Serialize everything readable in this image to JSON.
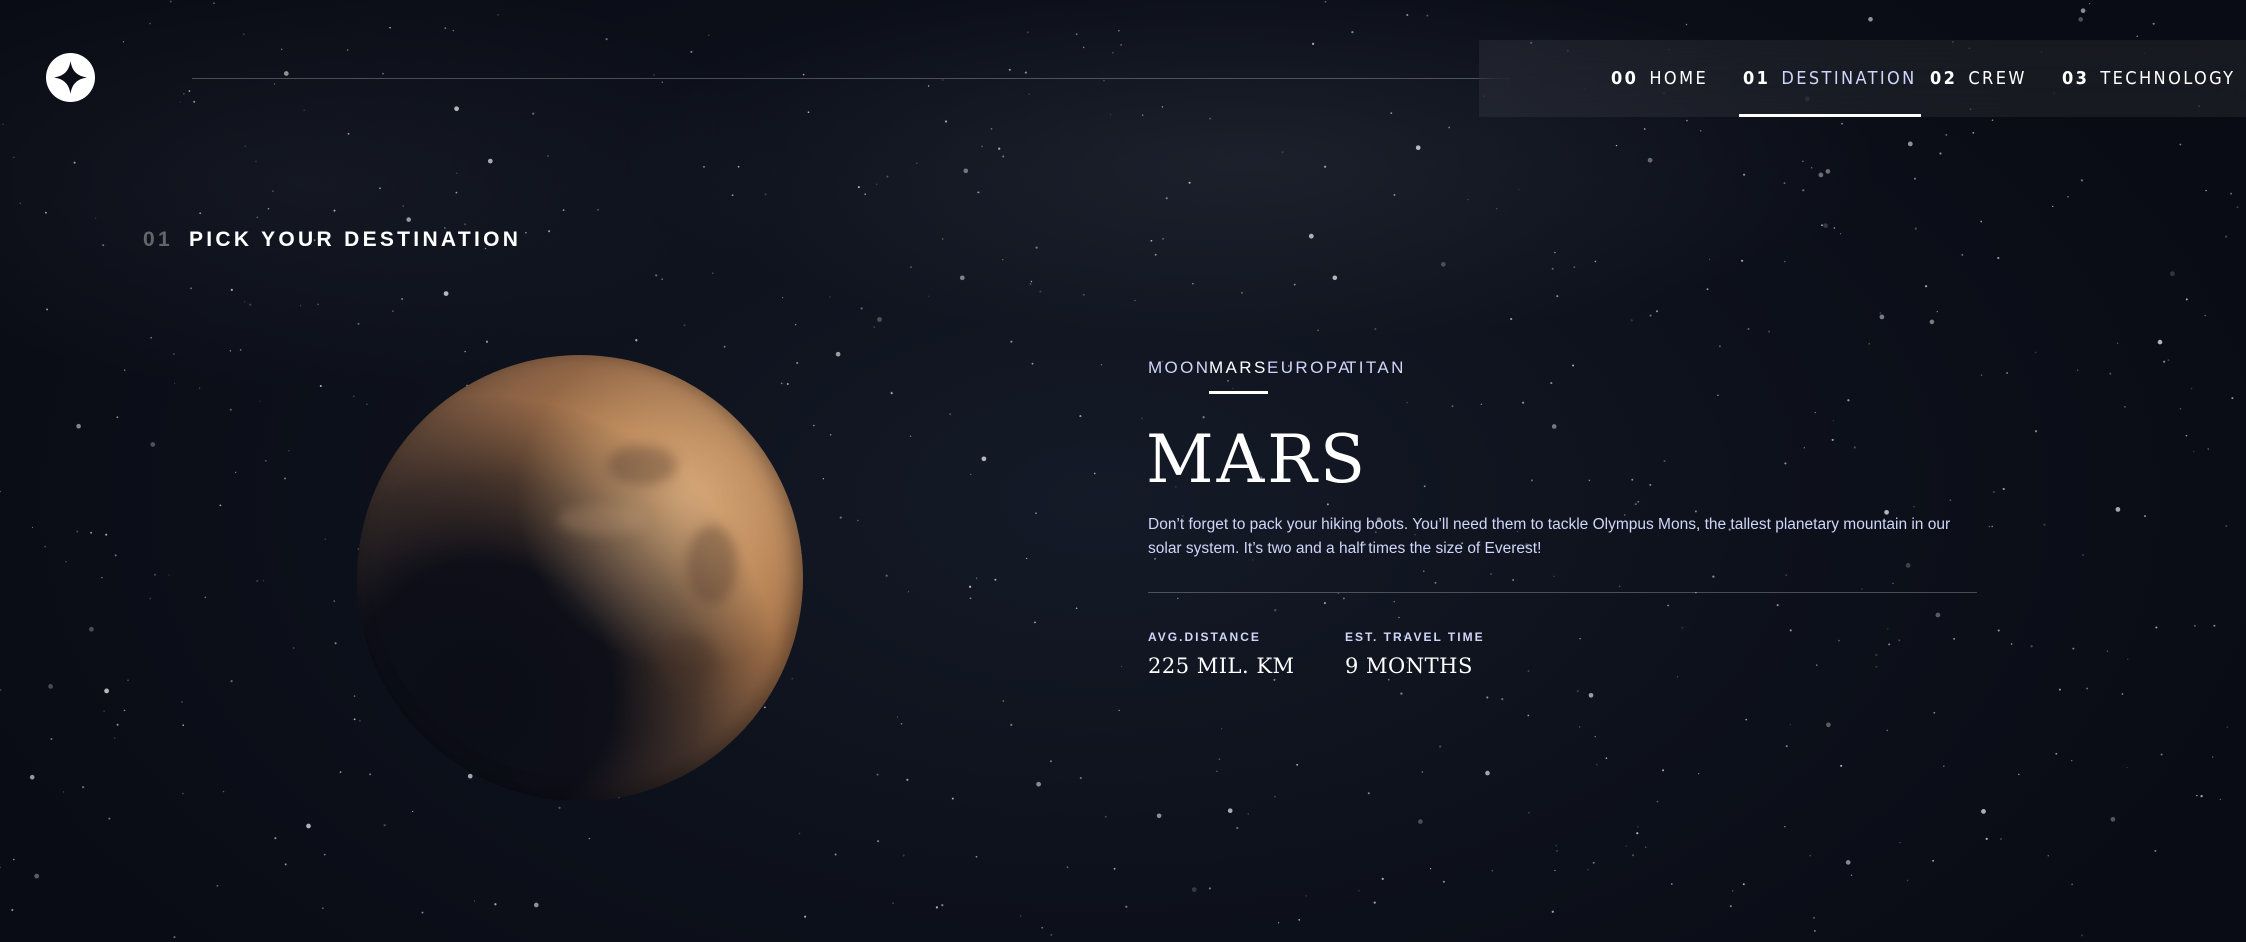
{
  "header": {
    "logo_icon": "star-logo-icon",
    "nav": [
      {
        "num": "00",
        "label": "HOME"
      },
      {
        "num": "01",
        "label": "DESTINATION"
      },
      {
        "num": "02",
        "label": "CREW"
      },
      {
        "num": "03",
        "label": "TECHNOLOGY"
      }
    ],
    "active_nav": "DESTINATION"
  },
  "page": {
    "heading_num": "01",
    "heading": "PICK YOUR DESTINATION"
  },
  "destination": {
    "tabs": [
      "MOON",
      "MARS",
      "EUROPA",
      "TITAN"
    ],
    "active_tab": "MARS",
    "name": "MARS",
    "description": "Don’t forget to pack your hiking boots. You’ll need them to tackle Olympus Mons, the tallest planetary mountain in our solar system. It’s two and a half times the size of Everest!",
    "stats": [
      {
        "label": "AVG.DISTANCE",
        "value": "225 MIL. KM"
      },
      {
        "label": "EST. TRAVEL TIME",
        "value": "9 MONTHS"
      }
    ]
  },
  "colors": {
    "background": "#0b0d17",
    "accent_text": "#d0d6f9",
    "white": "#ffffff"
  }
}
